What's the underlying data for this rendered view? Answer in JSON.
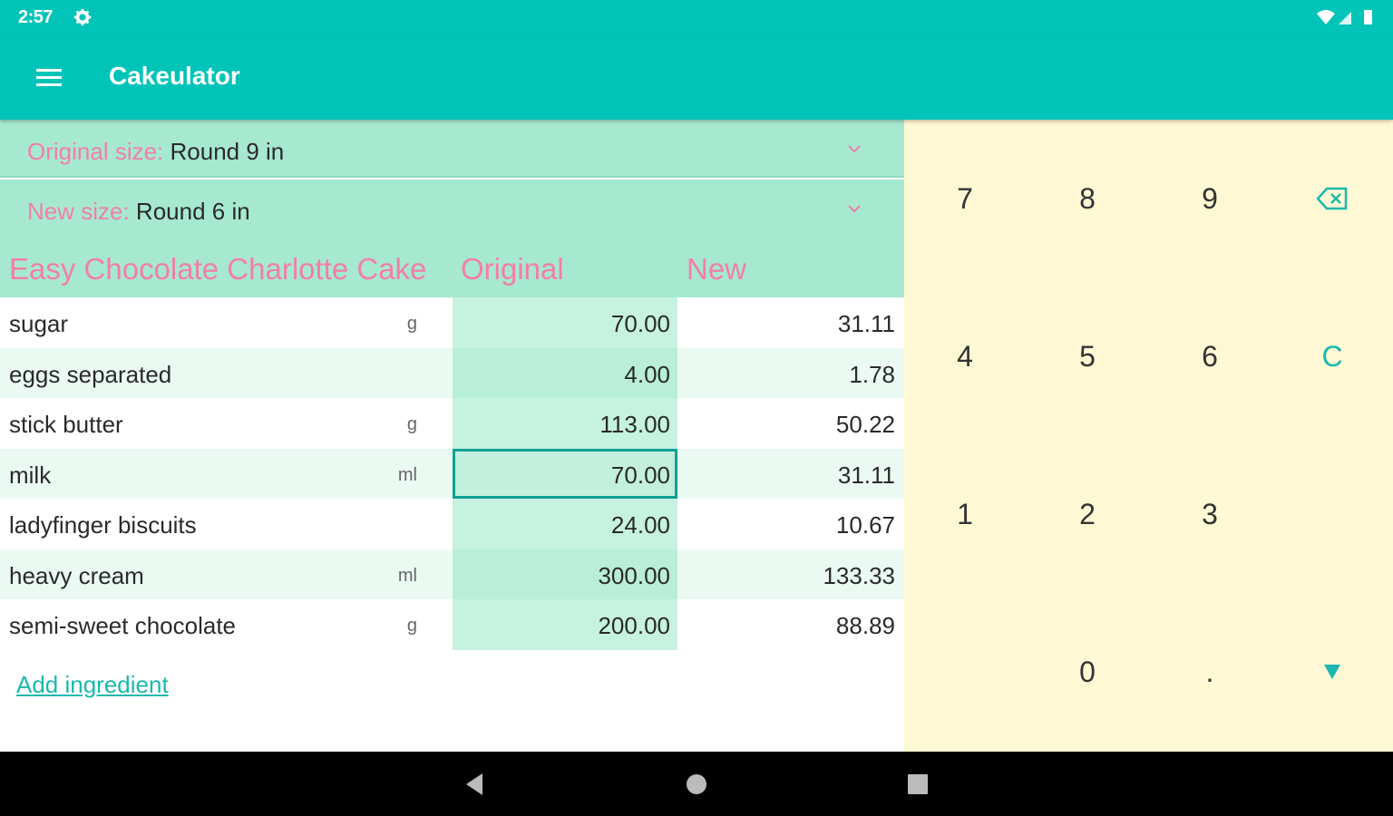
{
  "status": {
    "time": "2:57",
    "icons": [
      "gear-icon",
      "wifi-icon",
      "signal-icon",
      "battery-icon"
    ]
  },
  "app": {
    "title": "Cakeulator",
    "menu_icon": "hamburger-menu-icon"
  },
  "sizes": {
    "original_label": "Original size:",
    "original_value": " Round 9 in",
    "new_label": "New size:",
    "new_value": " Round 6 in"
  },
  "table": {
    "headers": {
      "name": "Easy Chocolate Charlotte Cake",
      "original": "Original",
      "new": "New"
    },
    "rows": [
      {
        "name": "sugar",
        "unit": "g",
        "original": "70.00",
        "new": "31.11"
      },
      {
        "name": "eggs separated",
        "unit": "",
        "original": "4.00",
        "new": "1.78"
      },
      {
        "name": "stick butter",
        "unit": "g",
        "original": "113.00",
        "new": "50.22"
      },
      {
        "name": "milk",
        "unit": "ml",
        "original": "70.00",
        "new": "31.11"
      },
      {
        "name": "ladyfinger biscuits",
        "unit": "",
        "original": "24.00",
        "new": "10.67"
      },
      {
        "name": "heavy cream",
        "unit": "ml",
        "original": "300.00",
        "new": "133.33"
      },
      {
        "name": "semi-sweet chocolate",
        "unit": "g",
        "original": "200.00",
        "new": "88.89"
      }
    ],
    "selected_row": 3
  },
  "add_ingredient": "Add ingredient",
  "keypad": {
    "keys": [
      "7",
      "8",
      "9",
      "4",
      "5",
      "6",
      "C",
      "1",
      "2",
      "3",
      "0",
      "."
    ],
    "backspace_icon": "backspace-icon",
    "down_icon": "triangle-down-icon"
  },
  "colors": {
    "primary": "#00c4b8",
    "accent_pink": "#f27fa6",
    "header_mint": "#a6e9d0",
    "keypad_bg": "#fff8d4"
  },
  "nav": {
    "icons": [
      "back-icon",
      "home-icon",
      "recents-icon"
    ]
  }
}
